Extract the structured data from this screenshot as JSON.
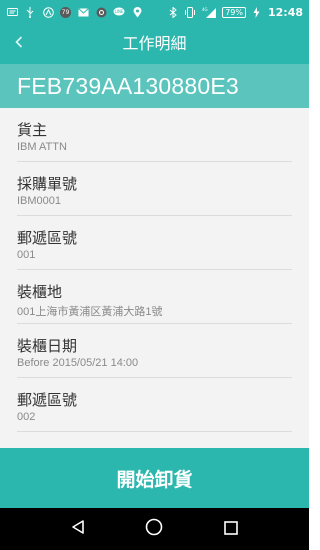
{
  "status_bar": {
    "icons": [
      "message-icon",
      "usb-icon",
      "app-icon",
      "notification-count-icon",
      "mail-icon",
      "app-circle-icon",
      "line-icon",
      "location-icon",
      "bluetooth-icon",
      "vibrate-icon",
      "signal-icon",
      "charging-icon"
    ],
    "notification_count": "79",
    "network": "4G",
    "battery": "79%",
    "time": "12:48"
  },
  "app_bar": {
    "back_icon": "chevron-left-icon",
    "title": "工作明細"
  },
  "id_bar": {
    "value": "FEB739AA130880E3"
  },
  "details": [
    {
      "label": "貨主",
      "value": "IBM ATTN"
    },
    {
      "label": "採購單號",
      "value": "IBM0001"
    },
    {
      "label": "郵遞區號",
      "value": "001"
    },
    {
      "label": "裝櫃地",
      "value": "001上海市黃浦区黃浦大路1號"
    },
    {
      "label": "裝櫃日期",
      "value": "Before 2015/05/21 14:00"
    },
    {
      "label": "郵遞區號",
      "value": "002"
    }
  ],
  "action_button": {
    "label": "開始卸貨"
  },
  "nav_bar": {
    "icons": [
      "back-triangle-icon",
      "home-circle-icon",
      "recents-square-icon"
    ]
  },
  "colors": {
    "primary": "#2bb7ad",
    "id_bar": "#5ac4bd",
    "list_bg": "#f3f3f3",
    "label": "#333333",
    "value": "#8a8a8a"
  }
}
